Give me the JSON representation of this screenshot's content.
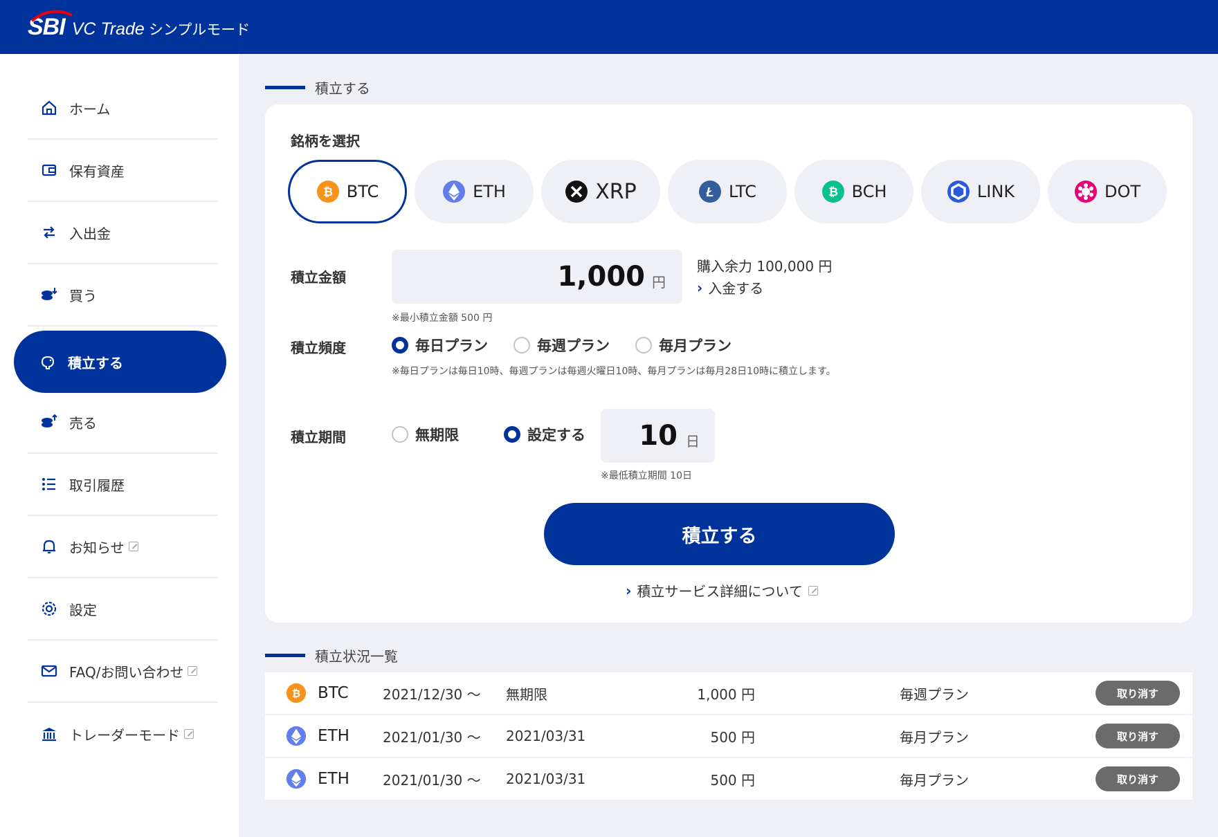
{
  "header": {
    "logo_brand": "SBI",
    "app_name": "VC Trade",
    "mode_label": "シンプルモード"
  },
  "sidebar": {
    "items": [
      {
        "label": "ホーム",
        "icon": "home-icon"
      },
      {
        "label": "保有資産",
        "icon": "wallet-icon"
      },
      {
        "label": "入出金",
        "icon": "transfer-icon"
      },
      {
        "label": "買う",
        "icon": "buy-coins-icon"
      },
      {
        "label": "積立する",
        "icon": "piggy-bank-icon",
        "active": true
      },
      {
        "label": "売る",
        "icon": "sell-coins-icon"
      },
      {
        "label": "取引履歴",
        "icon": "list-icon"
      },
      {
        "label": "お知らせ",
        "icon": "bell-icon",
        "external": true
      },
      {
        "label": "設定",
        "icon": "gear-icon"
      },
      {
        "label": "FAQ/お問い合わせ",
        "icon": "mail-icon",
        "external": true
      },
      {
        "label": "トレーダーモード",
        "icon": "bank-icon",
        "external": true
      }
    ]
  },
  "main": {
    "section_title": "積立する",
    "coin_select_label": "銘柄を選択",
    "coins": [
      {
        "symbol": "BTC",
        "color": "#f7931a",
        "selected": true
      },
      {
        "symbol": "ETH",
        "color": "#627eea"
      },
      {
        "symbol": "XRP",
        "color": "#111111"
      },
      {
        "symbol": "LTC",
        "color": "#345d9d"
      },
      {
        "symbol": "BCH",
        "color": "#0ac18e"
      },
      {
        "symbol": "LINK",
        "color": "#2a5ada"
      },
      {
        "symbol": "DOT",
        "color": "#e6007a"
      }
    ],
    "amount": {
      "label": "積立金額",
      "value": "1,000",
      "unit": "円",
      "note": "※最小積立金額 500 円",
      "available": "購入余力 100,000 円",
      "deposit_link": "入金する"
    },
    "frequency": {
      "label": "積立頻度",
      "options": [
        "毎日プラン",
        "毎週プラン",
        "毎月プラン"
      ],
      "selected": "毎日プラン",
      "note": "※毎日プランは毎日10時、毎週プランは毎週火曜日10時、毎月プランは毎月28日10時に積立します。"
    },
    "period": {
      "label": "積立期間",
      "option_unlimited": "無期限",
      "option_set": "設定する",
      "selected": "設定する",
      "value": "10",
      "unit": "日",
      "note": "※最低積立期間 10日"
    },
    "submit_label": "積立する",
    "service_link": "積立サービス詳細について"
  },
  "status": {
    "section_title": "積立状況一覧",
    "rows": [
      {
        "coin": "BTC",
        "start": "2021/12/30 〜",
        "end": "無期限",
        "amount": "1,000 円",
        "plan": "毎週プラン",
        "cancel": "取り消す"
      },
      {
        "coin": "ETH",
        "start": "2021/01/30 〜",
        "end": "2021/03/31",
        "amount": "500 円",
        "plan": "毎月プラン",
        "cancel": "取り消す"
      },
      {
        "coin": "ETH",
        "start": "2021/01/30 〜",
        "end": "2021/03/31",
        "amount": "500 円",
        "plan": "毎月プラン",
        "cancel": "取り消す"
      }
    ]
  },
  "colors": {
    "brand": "#00329b",
    "background": "#eef0f5",
    "cancel_button": "#6b6b6b"
  }
}
